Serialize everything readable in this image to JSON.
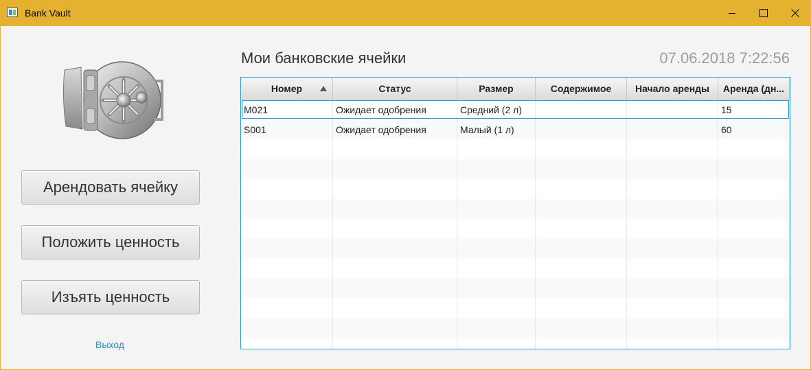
{
  "window": {
    "title": "Bank Vault"
  },
  "sidebar": {
    "buttons": [
      "Арендовать ячейку",
      "Положить ценность",
      "Изъять ценность"
    ],
    "exit_label": "Выход"
  },
  "main": {
    "heading": "Мои банковские ячейки",
    "datetime": "07.06.2018 7:22:56"
  },
  "table": {
    "columns": [
      "Номер",
      "Статус",
      "Размер",
      "Содержимое",
      "Начало аренды",
      "Аренда (дн..."
    ],
    "sorted_column": "Номер",
    "sort_direction": "ascending",
    "rows": [
      [
        "M021",
        "Ожидает одобрения",
        "Средний (2 л)",
        "",
        "",
        "15"
      ],
      [
        "S001",
        "Ожидает одобрения",
        "Малый (1 л)",
        "",
        "",
        "60"
      ]
    ]
  },
  "colors": {
    "titlebar": "#e4b22f",
    "accent": "#2a9ad4",
    "link": "#2a8bc4"
  }
}
